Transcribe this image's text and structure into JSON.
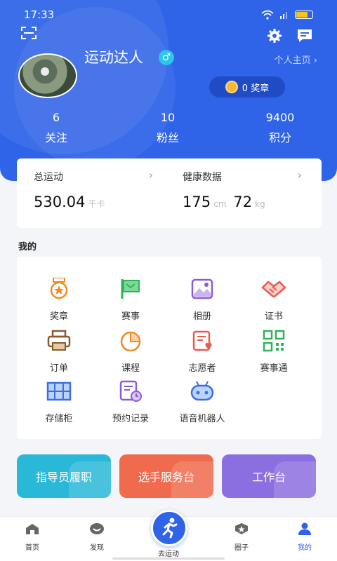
{
  "status": {
    "time": "17:33"
  },
  "profile": {
    "username": "运动达人",
    "gender_symbol": "♂",
    "homepage_label": "个人主页 ›",
    "medals_label": "0 奖章"
  },
  "stats": [
    {
      "value": "6",
      "label": "关注"
    },
    {
      "value": "10",
      "label": "粉丝"
    },
    {
      "value": "9400",
      "label": "积分"
    }
  ],
  "motion": {
    "total": {
      "title": "总运动",
      "value": "530.04",
      "unit": "千卡"
    },
    "health": {
      "title": "健康数据",
      "height": "175",
      "height_unit": "cm",
      "weight": "72",
      "weight_unit": "kg"
    }
  },
  "mine": {
    "title": "我的",
    "items": [
      {
        "label": "奖章",
        "icon": "medal-icon"
      },
      {
        "label": "赛事",
        "icon": "flag-icon"
      },
      {
        "label": "相册",
        "icon": "album-icon"
      },
      {
        "label": "证书",
        "icon": "handshake-icon"
      },
      {
        "label": "订单",
        "icon": "printer-icon"
      },
      {
        "label": "课程",
        "icon": "pie-chart-icon"
      },
      {
        "label": "志愿者",
        "icon": "clipboard-heart-icon"
      },
      {
        "label": "赛事通",
        "icon": "qrcode-icon"
      },
      {
        "label": "存储柜",
        "icon": "locker-icon"
      },
      {
        "label": "预约记录",
        "icon": "appointment-icon"
      },
      {
        "label": "语音机器人",
        "icon": "robot-icon"
      }
    ]
  },
  "banners": [
    {
      "label": "指导员履职"
    },
    {
      "label": "选手服务台"
    },
    {
      "label": "工作台"
    }
  ],
  "tabs": [
    {
      "label": "首页"
    },
    {
      "label": "发现"
    },
    {
      "label": "去运动"
    },
    {
      "label": "圈子"
    },
    {
      "label": "我的"
    }
  ],
  "colors": {
    "primary": "#2f63e8",
    "banner1": "#2ab8d8",
    "banner2": "#f06a4d",
    "banner3": "#8b6ee0",
    "icon_orange": "#f08a24",
    "icon_green": "#2fb35a",
    "icon_purple": "#8b5cd6",
    "icon_red": "#e85a4f",
    "icon_brown": "#8a5a2b",
    "icon_blue": "#3b6fe0"
  }
}
